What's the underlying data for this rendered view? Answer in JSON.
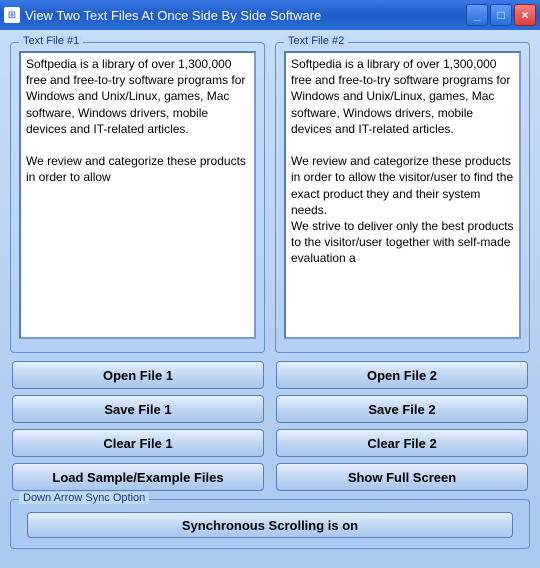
{
  "window": {
    "title": "View Two Text Files At Once Side By Side Software"
  },
  "panels": {
    "left": {
      "label": "Text File #1",
      "content": "Softpedia is a library of over 1,300,000 free and free-to-try software programs for Windows and Unix/Linux, games, Mac software, Windows drivers, mobile devices and IT-related articles.\n\nWe review and categorize these products in order to allow"
    },
    "right": {
      "label": "Text File #2",
      "content": "Softpedia is a library of over 1,300,000 free and free-to-try software programs for Windows and Unix/Linux, games, Mac software, Windows drivers, mobile devices and IT-related articles.\n\nWe review and categorize these products in order to allow the visitor/user to find the exact product they and their system needs.\nWe strive to deliver only the best products to the visitor/user together with self-made evaluation a"
    }
  },
  "buttons": {
    "open1": "Open File 1",
    "open2": "Open File 2",
    "save1": "Save File 1",
    "save2": "Save File 2",
    "clear1": "Clear File 1",
    "clear2": "Clear File 2",
    "loadSample": "Load Sample/Example Files",
    "fullscreen": "Show Full Screen"
  },
  "sync": {
    "label": "Down Arrow Sync Option",
    "status": "Synchronous Scrolling is on"
  }
}
